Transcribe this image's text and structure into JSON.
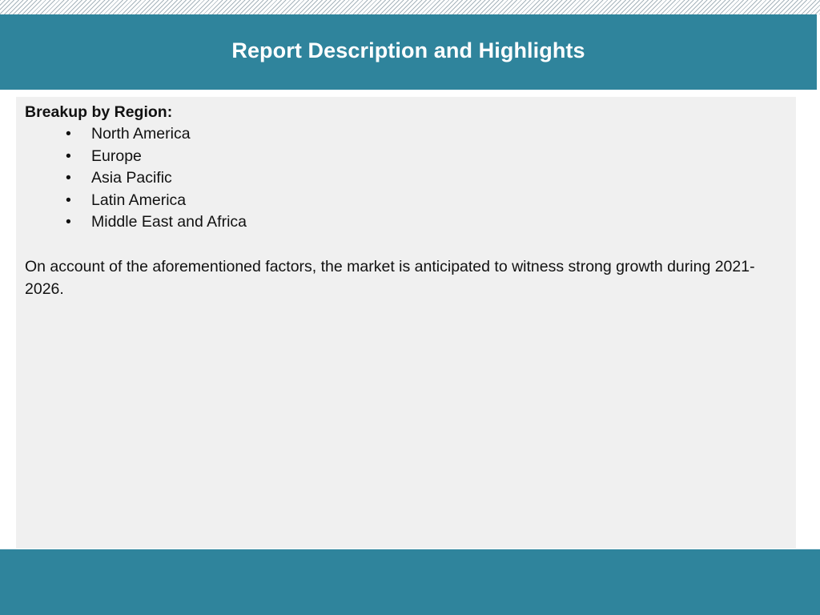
{
  "slide": {
    "title": "Report Description and Highlights",
    "accent_color": "#2f849c",
    "panel_color": "#f0f0f0"
  },
  "content": {
    "heading": "Breakup by Region:",
    "bullet_icon": "bullet-dot",
    "regions": [
      "North America",
      "Europe",
      "Asia Pacific",
      "Latin America",
      "Middle East and Africa"
    ],
    "summary": "On account of the aforementioned factors, the market is anticipated to witness strong growth during 2021-2026."
  }
}
